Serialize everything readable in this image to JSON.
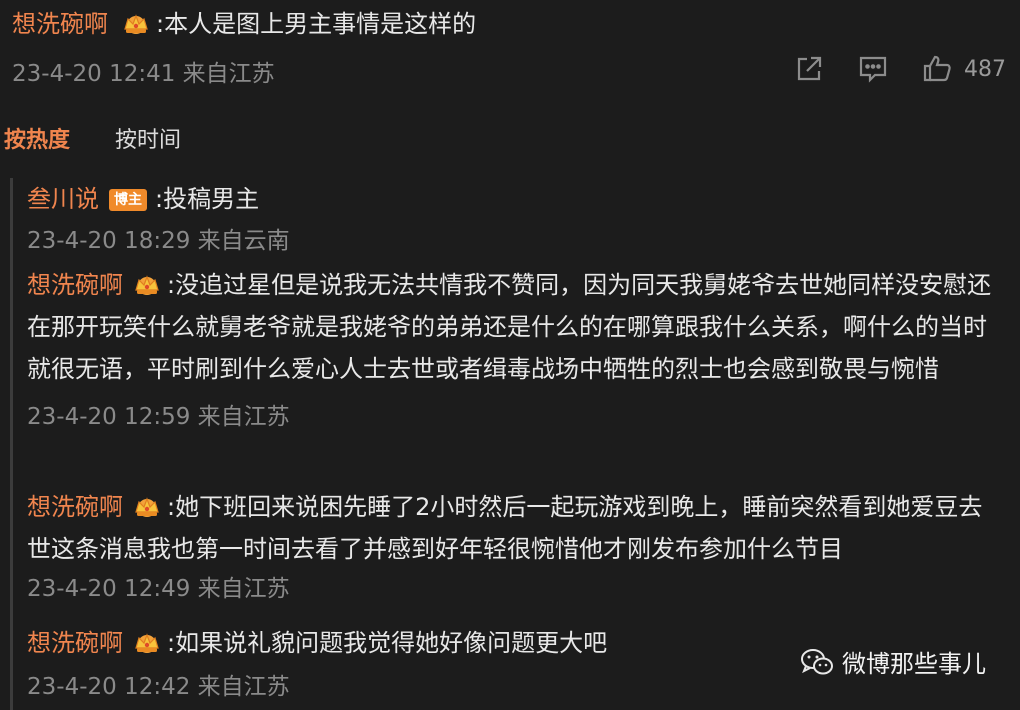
{
  "main_comment": {
    "username": "想洗碗啊",
    "text": ":本人是图上男主事情是这样的",
    "date": "23-4-20 12:41 来自江苏",
    "like_count": "487"
  },
  "sort_tabs": {
    "hot": "按热度",
    "time": "按时间"
  },
  "replies": [
    {
      "username": "叁川说",
      "badge": "博主",
      "text": ":投稿男主",
      "date": "23-4-20 18:29 来自云南"
    },
    {
      "username": "想洗碗啊",
      "text": ":没追过星但是说我无法共情我不赞同，因为同天我舅姥爷去世她同样没安慰还在那开玩笑什么就舅老爷就是我姥爷的弟弟还是什么的在哪算跟我什么关系，啊什么的当时就很无语，平时刷到什么爱心人士去世或者缉毒战场中牺牲的烈士也会感到敬畏与惋惜",
      "date": "23-4-20 12:59 来自江苏"
    },
    {
      "username": "想洗碗啊",
      "text": ":她下班回来说困先睡了2小时然后一起玩游戏到晚上，睡前突然看到她爱豆去世这条消息我也第一时间去看了并感到好年轻很惋惜他才刚发布参加什么节目",
      "date": "23-4-20 12:49 来自江苏"
    },
    {
      "username": "想洗碗啊",
      "text": ":如果说礼貌问题我觉得她好像问题更大吧",
      "date": "23-4-20 12:42 来自江苏"
    }
  ],
  "watermark": {
    "text": "微博那些事儿"
  },
  "icons": {
    "crown": "crown-icon",
    "share": "share-icon",
    "comment": "comment-icon",
    "like": "thumbs-up-icon",
    "wechat": "wechat-icon"
  },
  "colors": {
    "background": "#1c1c1c",
    "username": "#f0854e",
    "badge": "#f08a2a",
    "meta": "#8a8a8a"
  }
}
